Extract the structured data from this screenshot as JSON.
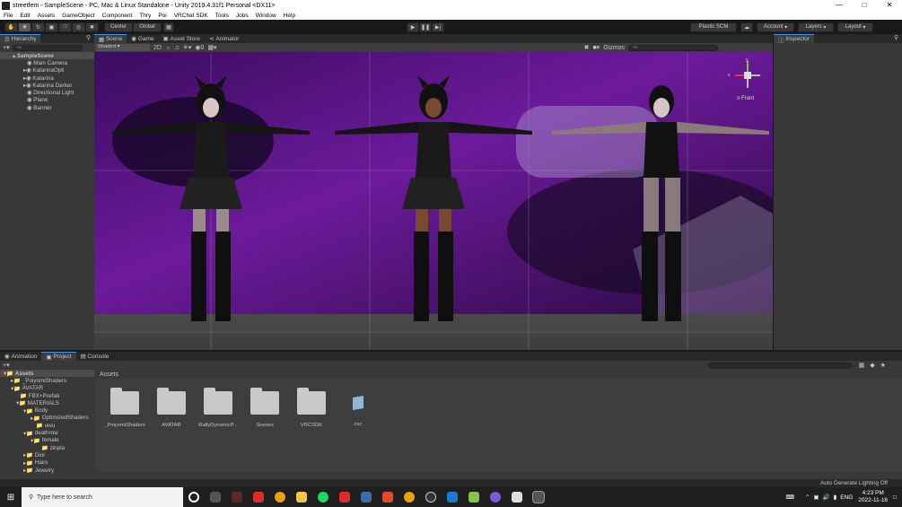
{
  "window": {
    "title": "streetfem - SampleScene - PC, Mac & Linux Standalone - Unity 2019.4.31f1 Personal <DX11>"
  },
  "menu": [
    "File",
    "Edit",
    "Assets",
    "GameObject",
    "Component",
    "Thry",
    "Poi",
    "VRChat SDK",
    "Tools",
    "Jobs",
    "Window",
    "Help"
  ],
  "toolbar": {
    "center": "Center",
    "global": "Global",
    "plastic": "Plastic SCM",
    "account": "Account",
    "layers": "Layers",
    "layout": "Layout"
  },
  "hierarchy": {
    "tab": "Hierarchy",
    "search_placeholder": "All",
    "scene": "SampleScene",
    "items": [
      "Main Camera",
      "KatarinaOpti",
      "Katarina",
      "Katarina Darker",
      "Directional Light",
      "Plane",
      "Banner"
    ]
  },
  "scene_tabs": [
    "Scene",
    "Game",
    "Asset Store",
    "Animator"
  ],
  "scene_toolbar": {
    "shading": "Shaded",
    "mode": "2D",
    "gizmos": "Gizmos",
    "search": "All"
  },
  "gizmo": {
    "label": "Front",
    "y": "y",
    "x": "x"
  },
  "inspector": {
    "tab": "Inspector"
  },
  "bottom_tabs": [
    "Animation",
    "Project",
    "Console"
  ],
  "project_tree": [
    {
      "label": "Assets",
      "indent": 0
    },
    {
      "label": "_PoiyomiShaders",
      "indent": 1
    },
    {
      "label": "AVATAR",
      "indent": 1
    },
    {
      "label": "FBX+Prefab",
      "indent": 2
    },
    {
      "label": "MATERIALS",
      "indent": 2
    },
    {
      "label": "Body",
      "indent": 3
    },
    {
      "label": "OptimizedShaders",
      "indent": 4
    },
    {
      "label": "uwu",
      "indent": 4
    },
    {
      "label": "deathrow",
      "indent": 3
    },
    {
      "label": "female",
      "indent": 4
    },
    {
      "label": "zinpia",
      "indent": 5
    },
    {
      "label": "Dior",
      "indent": 2
    },
    {
      "label": "Hairs",
      "indent": 2
    },
    {
      "label": "Jewelry",
      "indent": 2
    }
  ],
  "assets": {
    "header": "Assets",
    "items": [
      "_PoiyomiShaders",
      "AVATAR",
      "RallyDynamicP...",
      "Scenes",
      "VRCSDK",
      "csc"
    ]
  },
  "status": {
    "message": "Auto Generate Lighting Off"
  },
  "taskbar": {
    "search_placeholder": "Type here to search",
    "lang": "ENG",
    "time": "4:23 PM",
    "date": "2022-11-16"
  }
}
